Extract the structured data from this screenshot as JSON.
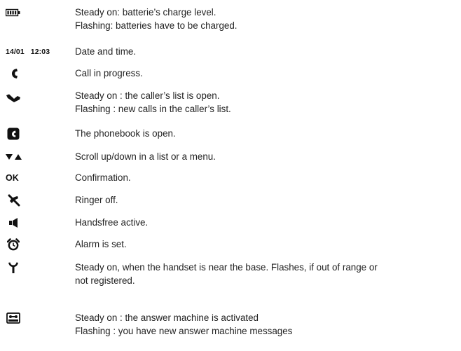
{
  "rows": [
    {
      "icon": "battery-icon",
      "lines": [
        "Steady on: batterie’s charge level.",
        "Flashing: batteries have to be charged."
      ]
    },
    {
      "icon": "date-time",
      "date": "14/01",
      "time": "12:03",
      "lines": [
        "Date and time."
      ]
    },
    {
      "icon": "handset-icon",
      "lines": [
        "Call in progress."
      ]
    },
    {
      "icon": "callers-list-icon",
      "lines": [
        "Steady on : the caller’s list is open.",
        "Flashing : new calls in the caller’s list."
      ]
    },
    {
      "icon": "phonebook-icon",
      "lines": [
        "The phonebook is open."
      ]
    },
    {
      "icon": "scroll-arrows-icon",
      "lines": [
        "Scroll up/down in a list or a menu."
      ]
    },
    {
      "icon": "ok-label",
      "label": "OK",
      "lines": [
        "Confirmation."
      ]
    },
    {
      "icon": "ringer-off-icon",
      "lines": [
        "Ringer off."
      ]
    },
    {
      "icon": "speaker-icon",
      "lines": [
        "Handsfree active."
      ]
    },
    {
      "icon": "alarm-clock-icon",
      "lines": [
        "Alarm is set."
      ]
    },
    {
      "icon": "antenna-icon",
      "lines": [
        "Steady on, when the handset is near the base. Flashes, if out of range or",
        "not registered."
      ]
    },
    {
      "icon": "answer-machine-icon",
      "lines": [
        "Steady on : the answer machine is activated",
        "Flashing : you have new answer machine messages"
      ]
    }
  ]
}
